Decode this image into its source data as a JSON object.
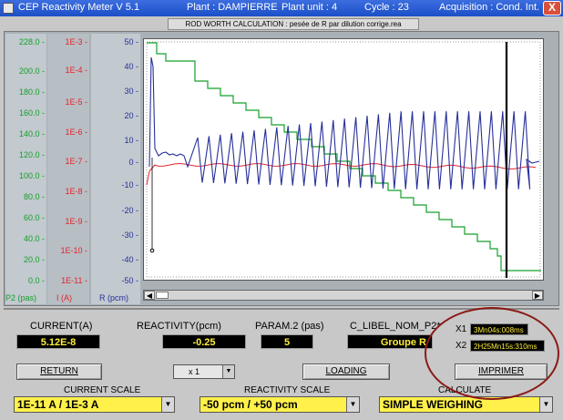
{
  "titlebar": {
    "app": "CEP Reactivity Meter  V 5.1",
    "plant": "Plant : DAMPIERRE",
    "unit": "Plant unit : 4",
    "cycle": "Cycle : 23",
    "acquisition": "Acquisition : Cond. Int.",
    "close": "X"
  },
  "subtitle": "ROD WORTH CALCULATION : pesée de R par dilution corrige.rea",
  "axes": {
    "p2": {
      "ticks": [
        "228.0 -",
        "200.0 -",
        "180.0 -",
        "160.0 -",
        "140.0 -",
        "120.0 -",
        "100.0 -",
        "80.0 -",
        "60.0 -",
        "40.0 -",
        "20.0 -",
        "0.0 -"
      ],
      "unit": "P2 (pas)",
      "color": "#14a02a"
    },
    "current": {
      "ticks": [
        "1E-3 -",
        "1E-4 -",
        "1E-5 -",
        "1E-6 -",
        "1E-7 -",
        "1E-8 -",
        "1E-9 -",
        "1E-10 -",
        "1E-11 -"
      ],
      "unit": "I (A)",
      "color": "#e0262e"
    },
    "reactivity": {
      "ticks": [
        "50 -",
        "40 -",
        "30 -",
        "20 -",
        "10 -",
        "0 -",
        "-10 -",
        "-20 -",
        "-30 -",
        "-40 -",
        "-50 -"
      ],
      "unit": "R (pcm)",
      "color": "#27309a"
    }
  },
  "readouts": {
    "current_label": "CURRENT(A)",
    "current_value": "5.12E-8",
    "reactivity_label": "REACTIVITY(pcm)",
    "reactivity_value": "-0.25",
    "param2_label": "PARAM.2 (pas)",
    "param2_value": "5",
    "libel_label": "C_LIBEL_NOM_P2*",
    "libel_value": "Groupe R",
    "x1_label": "X1",
    "x1_value": "3Mn04s:008ms",
    "x2_label": "X2",
    "x2_value": "2H25Mn15s:310ms"
  },
  "buttons": {
    "return": "RETURN",
    "zoom": "x 1",
    "loading": "LOADING",
    "print": "IMPRIMER"
  },
  "scales": {
    "current_label": "CURRENT SCALE",
    "current_value": "1E-11 A / 1E-3 A",
    "reactivity_label": "REACTIVITY SCALE",
    "reactivity_value": "-50 pcm / +50 pcm",
    "calculate_label": "CALCULATE",
    "calculate_value": "SIMPLE WEIGHING"
  },
  "colors": {
    "p2_trace": "#14a02a",
    "current_trace": "#e0262e",
    "reactivity_trace": "#27309a",
    "readout_text": "#ffef3a"
  }
}
